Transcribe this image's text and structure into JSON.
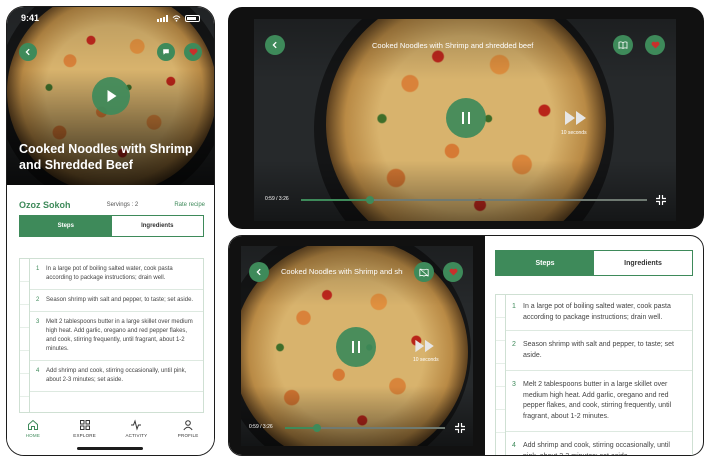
{
  "phone": {
    "status_time": "9:41",
    "title_line1": "Cooked Noodles with Shrimp",
    "title_line2": "and Shredded Beef",
    "author": "Ozoz Sokoh",
    "servings": "Servings : 2",
    "rate_label": "Rate recipe",
    "nav": [
      {
        "label": "HOME",
        "icon": "home-icon"
      },
      {
        "label": "EXPLORE",
        "icon": "grid-icon"
      },
      {
        "label": "ACTIVITY",
        "icon": "activity-icon"
      },
      {
        "label": "PROFILE",
        "icon": "profile-icon"
      }
    ]
  },
  "tabs": {
    "steps": "Steps",
    "ingredients": "Ingredients"
  },
  "steps": [
    {
      "num": "1",
      "text": "In a large pot of boiling salted water, cook pasta according to package instructions; drain well."
    },
    {
      "num": "2",
      "text": "Season shrimp with salt and pepper, to taste; set aside."
    },
    {
      "num": "3",
      "text": "Melt 2 tablespoons butter in a large skillet over medium high heat. Add garlic, oregano and red pepper flakes, and cook, stirring frequently, until fragrant, about 1-2 minutes."
    },
    {
      "num": "4",
      "text": "Add shrimp and cook, stirring occasionally, until pink, about 2-3 minutes; set aside."
    }
  ],
  "player_full": {
    "title": "Cooked Noodles with Shrimp and shredded beef",
    "seek": "10 seconds",
    "time": "0:59 / 3:26",
    "progress": 0.2
  },
  "player_split": {
    "title": "Cooked Noodles with Shrimp and shredded beef",
    "seek": "10 seconds",
    "time": "0:59 / 3:26",
    "progress": 0.2
  },
  "colors": {
    "accent": "#3e8a5a",
    "favorite": "#c9302c"
  }
}
